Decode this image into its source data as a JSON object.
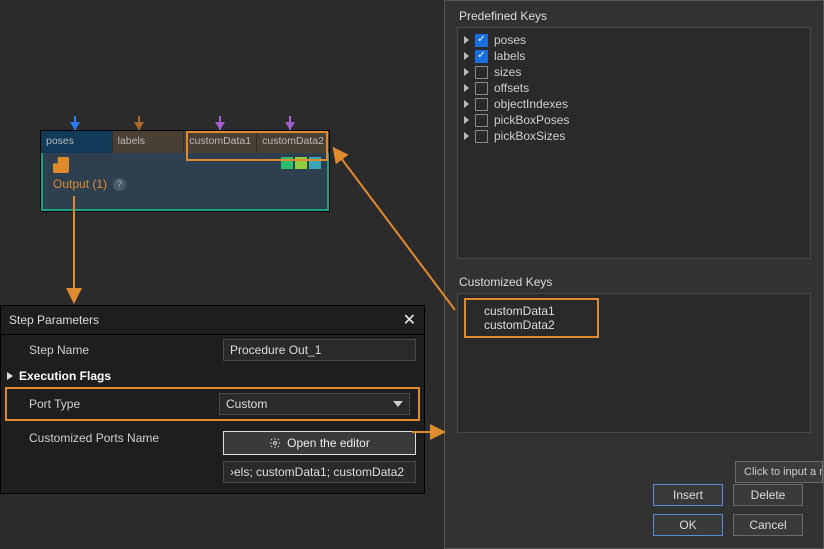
{
  "node": {
    "ports": [
      {
        "type": "<PoseList>",
        "name": "poses",
        "klass": "port-poses"
      },
      {
        "type": "<StringList>",
        "name": "labels",
        "klass": "port-labels"
      },
      {
        "type": "<NumberList>",
        "name": "customData1",
        "klass": "port-custom"
      },
      {
        "type": "<NumberList>",
        "name": "customData2",
        "klass": "port-custom"
      }
    ],
    "title": "Output (1)"
  },
  "stepParams": {
    "panelTitle": "Step Parameters",
    "stepNameLabel": "Step Name",
    "stepNameValue": "Procedure Out_1",
    "execFlagsLabel": "Execution Flags",
    "portTypeLabel": "Port Type",
    "portTypeValue": "Custom",
    "customizedPortsLabel": "Customized Ports Name",
    "openEditorLabel": "Open the editor",
    "customizedPortsValue": "›els; customData1; customData2"
  },
  "dialog": {
    "predefLabel": "Predefined Keys",
    "predefKeys": [
      {
        "name": "poses",
        "checked": true
      },
      {
        "name": "labels",
        "checked": true
      },
      {
        "name": "sizes",
        "checked": false
      },
      {
        "name": "offsets",
        "checked": false
      },
      {
        "name": "objectIndexes",
        "checked": false
      },
      {
        "name": "pickBoxPoses",
        "checked": false
      },
      {
        "name": "pickBoxSizes",
        "checked": false
      }
    ],
    "customLabel": "Customized Keys",
    "customKeys": [
      "customData1",
      "customData2"
    ],
    "newKeyHint": "Click to input a n",
    "buttons": {
      "insert": "Insert",
      "delete": "Delete",
      "ok": "OK",
      "cancel": "Cancel"
    }
  }
}
